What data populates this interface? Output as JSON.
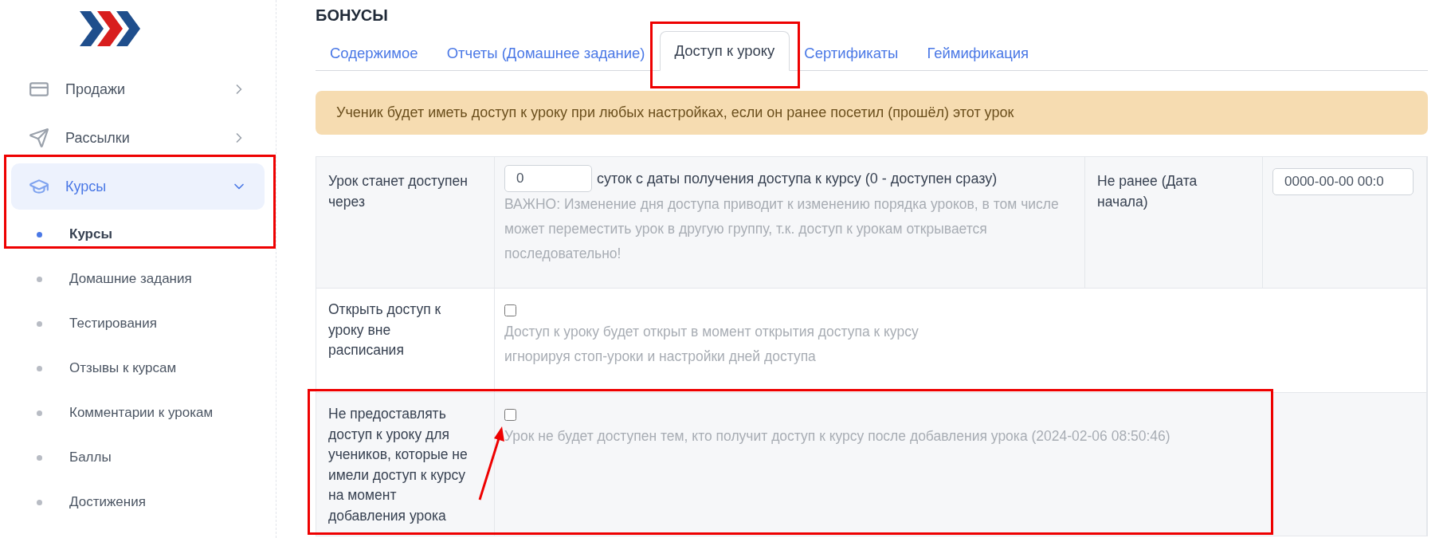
{
  "sidebar": {
    "items": [
      {
        "label": "Продажи",
        "expanded": false,
        "selected": false
      },
      {
        "label": "Рассылки",
        "expanded": false,
        "selected": false
      },
      {
        "label": "Курсы",
        "expanded": true,
        "selected": true,
        "children": [
          {
            "label": "Курсы",
            "selected": true
          },
          {
            "label": "Домашние задания",
            "selected": false
          },
          {
            "label": "Тестирования",
            "selected": false
          },
          {
            "label": "Отзывы к курсам",
            "selected": false
          },
          {
            "label": "Комментарии к урокам",
            "selected": false
          },
          {
            "label": "Баллы",
            "selected": false
          },
          {
            "label": "Достижения",
            "selected": false
          }
        ]
      }
    ]
  },
  "page_title": "БОНУСЫ",
  "tabs": [
    {
      "label": "Содержимое",
      "selected": false
    },
    {
      "label": "Отчеты (Домашнее задание)",
      "selected": false
    },
    {
      "label": "Доступ к уроку",
      "selected": true
    },
    {
      "label": "Сертификаты",
      "selected": false
    },
    {
      "label": "Геймификация",
      "selected": false
    }
  ],
  "alert": "Ученик будет иметь доступ к уроку при любых настройках, если он ранее посетил (прошёл) этот урок",
  "form_rows": [
    {
      "kind": "delay",
      "label": "Урок станет доступен через",
      "value": "0",
      "suffix": "суток с даты получения доступа к курсу (0 - доступен сразу)",
      "note_lines": [
        "ВАЖНО: Изменение дня доступа приводит к изменению порядка уроков, в том числе может переместить урок в другую группу, т.к. доступ к урокам открывается последовательно!"
      ],
      "second_label": "Не ранее (Дата начала)",
      "date_value": "0000-00-00 00:0"
    },
    {
      "kind": "checkbox",
      "label": "Открыть доступ к уроку вне расписания",
      "checked": false,
      "note_lines": [
        "Доступ к уроку будет открыт в момент открытия доступа к курсу",
        "игнорируя стоп-уроки и настройки дней доступа"
      ]
    },
    {
      "kind": "checkbox",
      "label": "Не предоставлять доступ к уроку для учеников, которые не имели доступ к курсу на момент добавления урока",
      "checked": false,
      "note_lines": [
        "Урок не будет доступен тем, кто получит доступ к курсу после добавления урока (2024-02-06 08:50:46)"
      ]
    }
  ]
}
